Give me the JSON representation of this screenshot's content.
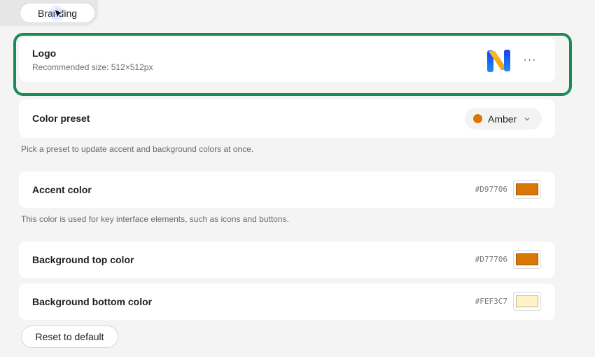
{
  "tabs": {
    "active_label": "Branding"
  },
  "logo": {
    "title": "Logo",
    "subtitle": "Recommended size: 512×512px",
    "more_label": "···"
  },
  "color_preset": {
    "title": "Color preset",
    "selected": "Amber",
    "dot_color": "#D97706",
    "helper": "Pick a preset to update accent and background colors at once."
  },
  "accent": {
    "title": "Accent color",
    "hex": "#D97706",
    "color": "#D97706",
    "helper": "This color is used for key interface elements, such as icons and buttons."
  },
  "bg_top": {
    "title": "Background top color",
    "hex": "#D77706",
    "color": "#D77706"
  },
  "bg_bottom": {
    "title": "Background bottom color",
    "hex": "#FEF3C7",
    "color": "#FEF3C7"
  },
  "reset_label": "Reset to default",
  "highlight_color": "#1C8A57"
}
